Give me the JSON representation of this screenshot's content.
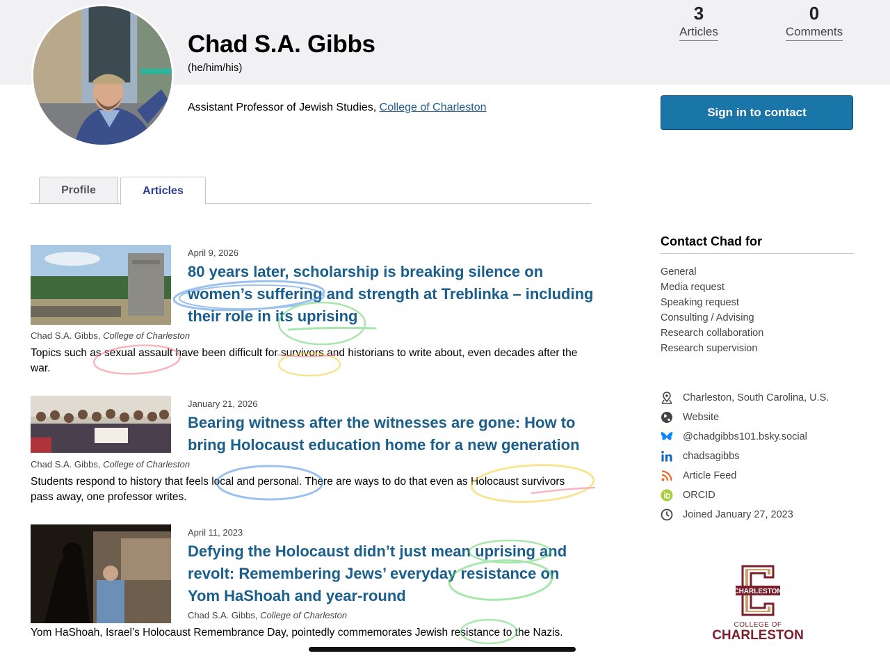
{
  "profile": {
    "name": "Chad S.A. Gibbs",
    "pronouns": "(he/him/his)",
    "role_prefix": "Assistant Professor of Jewish Studies, ",
    "institution": "College of Charleston"
  },
  "stats": [
    {
      "value": "3",
      "label": "Articles"
    },
    {
      "value": "0",
      "label": "Comments"
    }
  ],
  "signin_label": "Sign in to contact",
  "tabs": [
    {
      "label": "Profile",
      "active": false
    },
    {
      "label": "Articles",
      "active": true
    }
  ],
  "articles": [
    {
      "date": "April 9, 2026",
      "title": "80 years later, scholarship is breaking silence on women’s suffering and strength at Treblinka – including their role in its uprising",
      "author": "Chad S.A. Gibbs, ",
      "author_inst": "College of Charleston",
      "summary": "Topics such as sexual assault have been difficult for survivors and historians to write about, even decades after the war."
    },
    {
      "date": "January 21, 2026",
      "title": "Bearing witness after the witnesses are gone: How to bring Holocaust education home for a new generation",
      "author": "Chad S.A. Gibbs, ",
      "author_inst": "College of Charleston",
      "summary": "Students respond to history that feels local and personal. There are ways to do that even as Holocaust survivors pass away, one professor writes."
    },
    {
      "date": "April 11, 2023",
      "title": "Defying the Holocaust didn’t just mean uprising and revolt: Remembering Jews’ everyday resistance on Yom HaShoah and year-round",
      "author": "Chad S.A. Gibbs, ",
      "author_inst": "College of Charleston",
      "summary": "Yom HaShoah, Israel’s Holocaust Remembrance Day, pointedly commemorates Jewish resistance to the Nazis."
    }
  ],
  "contact": {
    "title": "Contact Chad for",
    "items": [
      "General",
      "Media request",
      "Speaking request",
      "Consulting / Advising",
      "Research collaboration",
      "Research supervision"
    ]
  },
  "info": [
    {
      "icon": "location-icon",
      "text": "Charleston, South Carolina, U.S."
    },
    {
      "icon": "globe-icon",
      "text": "Website"
    },
    {
      "icon": "bluesky-icon",
      "text": "@chadgibbs101.bsky.social"
    },
    {
      "icon": "linkedin-icon",
      "text": "chadsagibbs"
    },
    {
      "icon": "rss-icon",
      "text": "Article Feed"
    },
    {
      "icon": "orcid-icon",
      "text": "ORCID"
    },
    {
      "icon": "clock-icon",
      "text": "Joined January 27, 2023"
    }
  ],
  "logo": {
    "badge_text": "CHARLESTON",
    "line1": "COLLEGE OF",
    "line2": "CHARLESTON"
  },
  "colors": {
    "accent": "#1a75a8",
    "title_link": "#1a5e8c",
    "tab_active": "#2a3d8f",
    "brand_maroon": "#7a1f2b"
  }
}
